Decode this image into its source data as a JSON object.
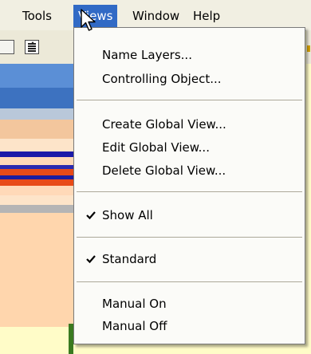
{
  "menubar": {
    "items": [
      {
        "label": "Tools"
      },
      {
        "label": "Views"
      },
      {
        "label": "Window"
      },
      {
        "label": "Help"
      }
    ]
  },
  "views_menu": {
    "items": [
      {
        "label": "Name Layers..."
      },
      {
        "label": "Controlling Object..."
      },
      {
        "label": "Create Global View..."
      },
      {
        "label": "Edit Global View..."
      },
      {
        "label": "Delete Global View..."
      },
      {
        "label": "Show All",
        "checked": true
      },
      {
        "label": "Standard",
        "checked": true
      },
      {
        "label": "Manual On"
      },
      {
        "label": "Manual Off"
      }
    ]
  },
  "colors": {
    "highlight": "#316ac5",
    "background": "#fffcc8",
    "menubar": "#f1efe2"
  },
  "icons": {
    "checkmark": "check-icon",
    "pointer": "mouse-pointer-icon"
  }
}
